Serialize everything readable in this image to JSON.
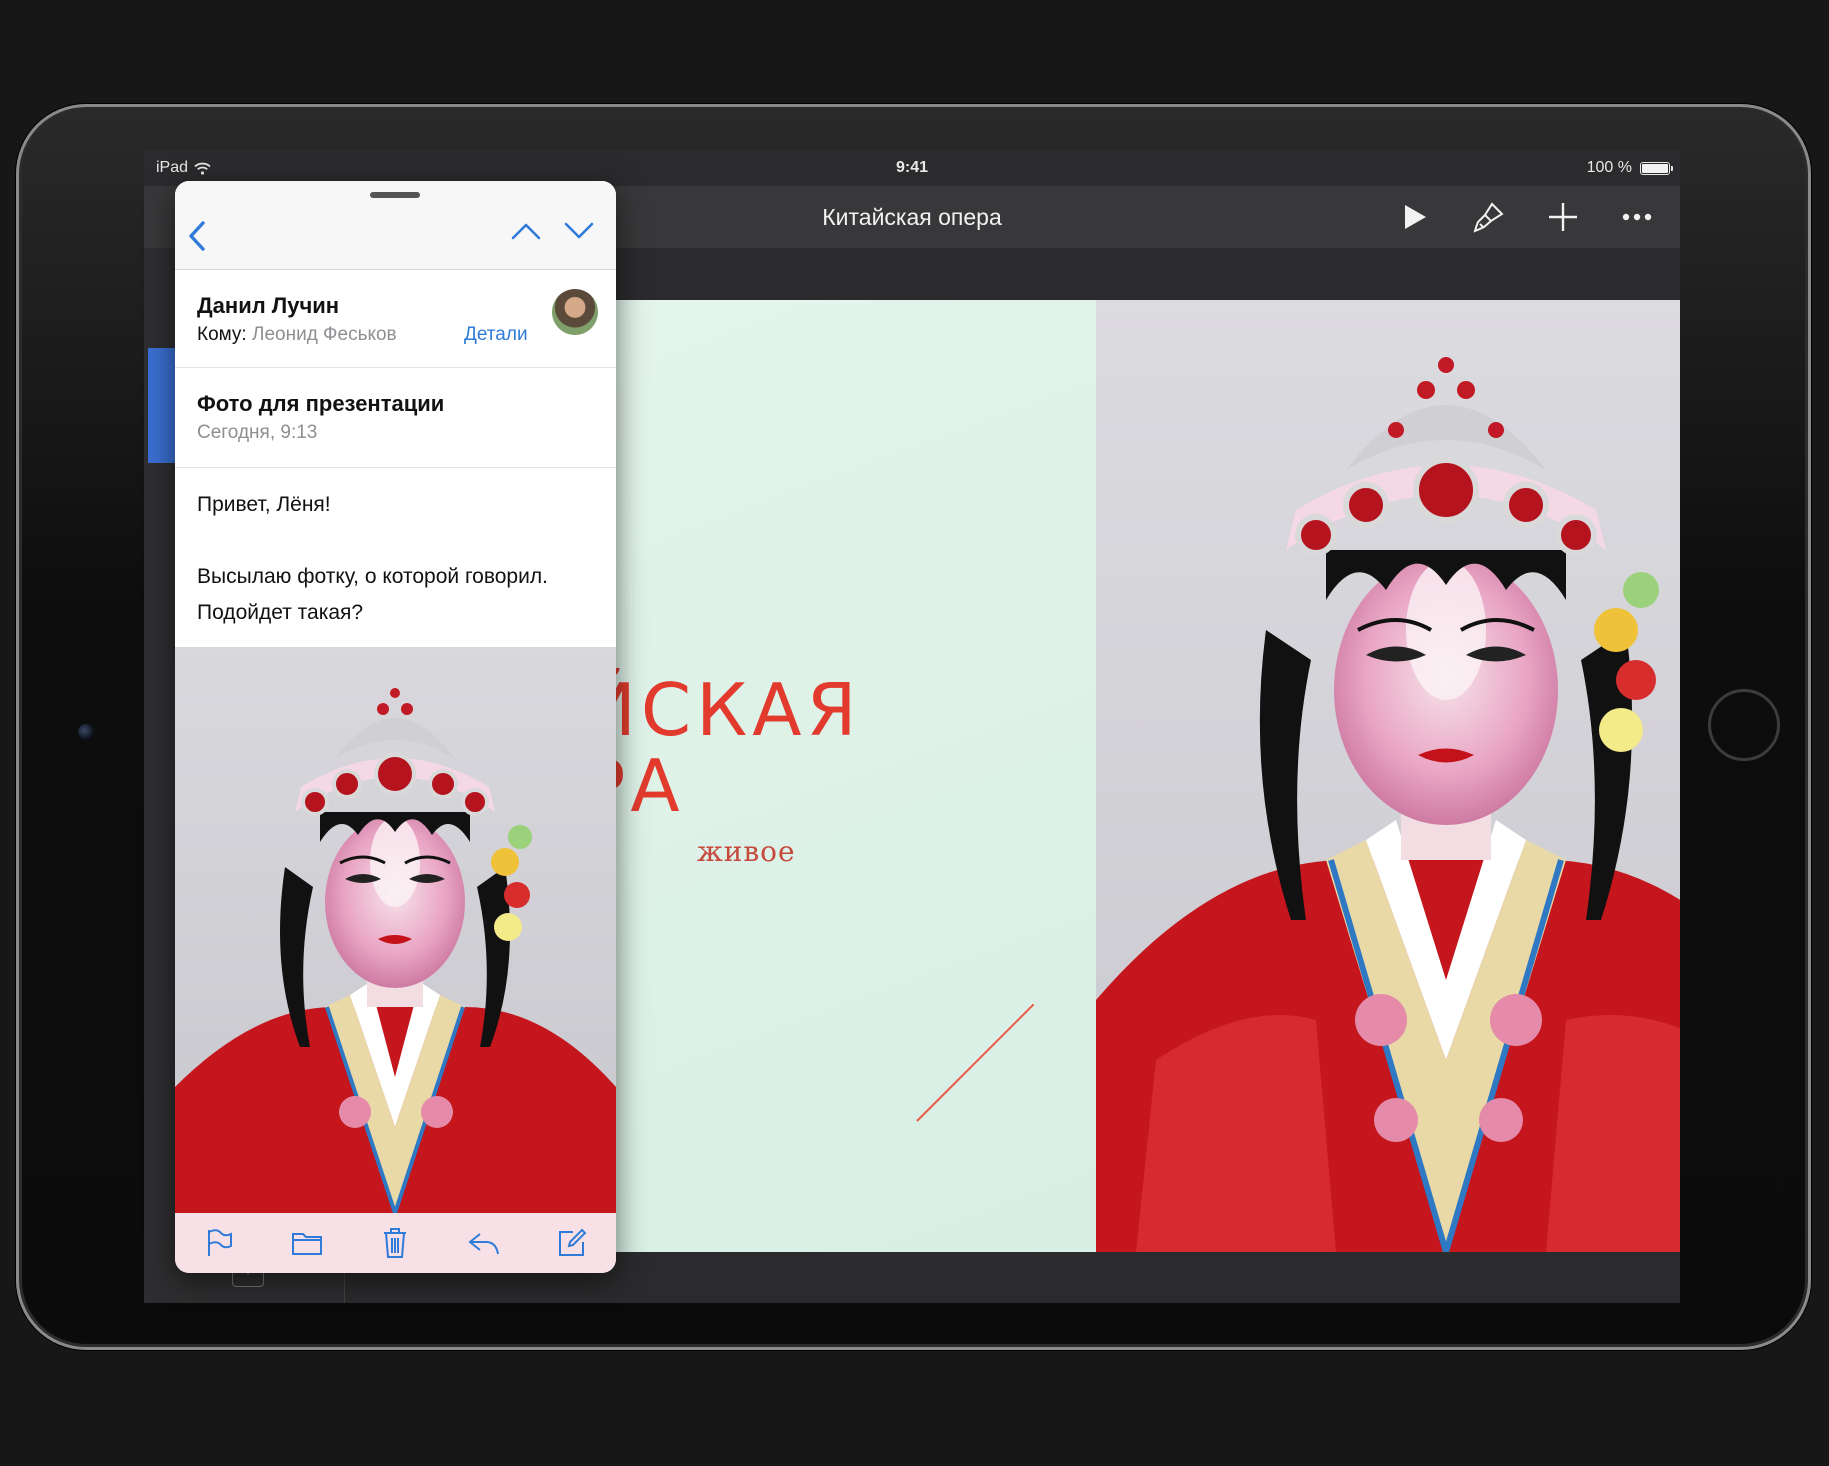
{
  "status_bar": {
    "device": "iPad",
    "time": "9:41",
    "battery": "100 %",
    "battery_level": 1.0
  },
  "keynote": {
    "document_title": "Китайская опера",
    "toolbar": {
      "play_icon": "play-icon",
      "format_icon": "paintbrush-icon",
      "add_icon": "plus-icon",
      "more_icon": "more-icon"
    },
    "slide": {
      "title_line1": "ЙСКАЯ",
      "title_line2": "РА",
      "subtitle": "живое",
      "accent_color": "#e23b2e",
      "background_color": "#e4f4ec"
    }
  },
  "mail": {
    "nav": {
      "back_icon": "chevron-left-icon",
      "prev_icon": "chevron-up-icon",
      "next_icon": "chevron-down-icon"
    },
    "sender": "Данил Лучин",
    "to_label": "Кому:",
    "to_value": "Леонид Феськов",
    "details_label": "Детали",
    "subject": "Фото для презентации",
    "date": "Сегодня, 9:13",
    "body": [
      "Привет, Лёня!",
      "Высылаю фотку, о которой говорил. Подойдет такая?"
    ],
    "toolbar": [
      "flag-icon",
      "folder-icon",
      "trash-icon",
      "reply-icon",
      "compose-icon"
    ],
    "link_color": "#2f7bd9"
  }
}
